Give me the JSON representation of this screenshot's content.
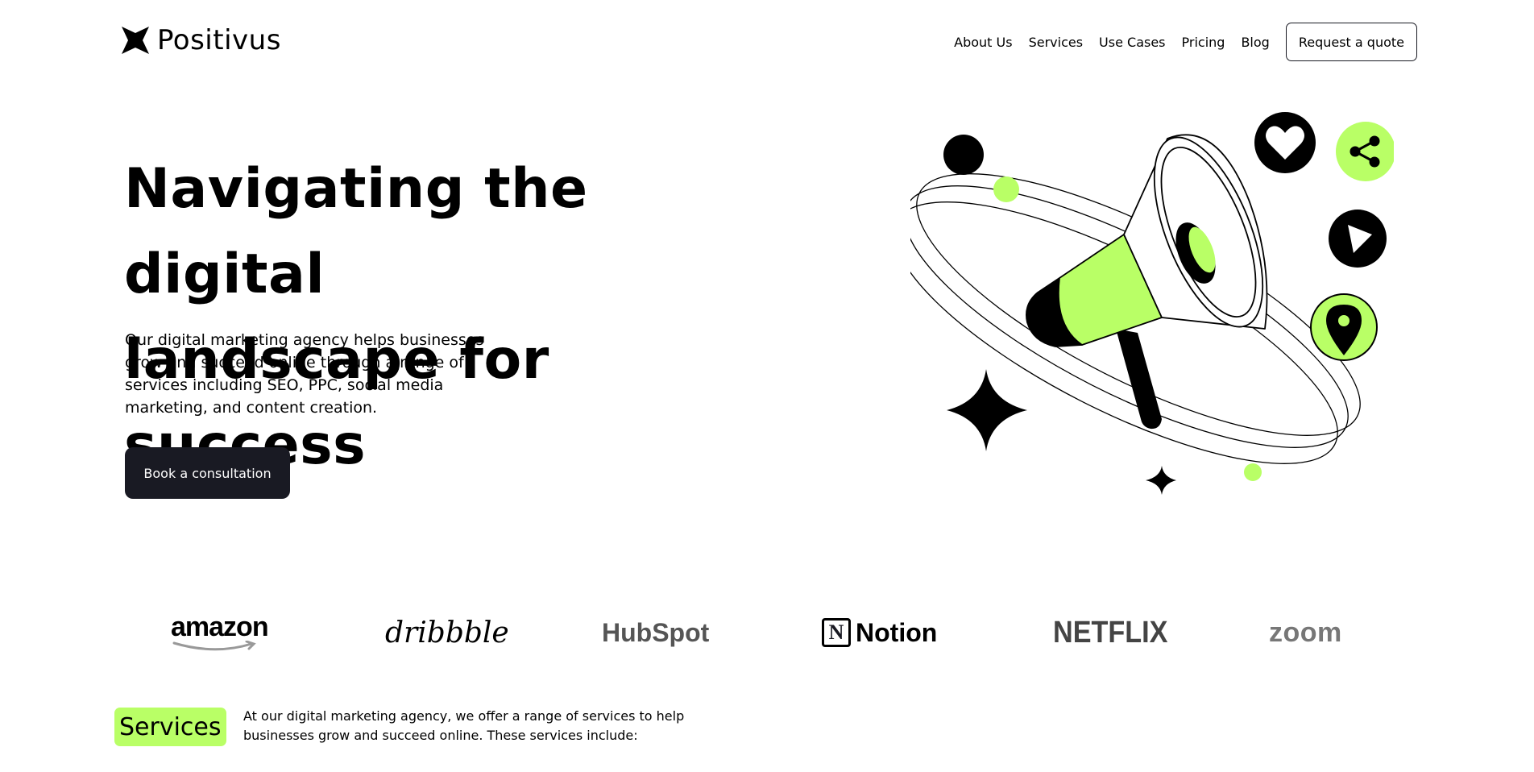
{
  "brand": {
    "name": "Positivus",
    "logo_icon": "star-burst-icon"
  },
  "nav": {
    "links": [
      "About Us",
      "Services",
      "Use Cases",
      "Pricing",
      "Blog"
    ],
    "cta_label": "Request a quote"
  },
  "hero": {
    "title_line1": "Navigating the digital",
    "title_line2": "landscape for success",
    "description": "Our digital marketing agency helps businesses grow and succeed online through a range of services including SEO, PPC, social media marketing, and content creation.",
    "cta_label": "Book a consultation"
  },
  "logos": {
    "amazon": "amazon",
    "dribbble": "dribbble",
    "hubspot": "HubSpot",
    "notion": "Notion",
    "netflix": "NETFLIX",
    "zoom": "zoom"
  },
  "services": {
    "title": "Services",
    "description": "At our digital marketing agency, we offer a range of services to help businesses grow and succeed online. These services include:"
  },
  "colors": {
    "accent": "#B9FF66",
    "dark": "#191A23",
    "background": "#FFFFFF"
  }
}
